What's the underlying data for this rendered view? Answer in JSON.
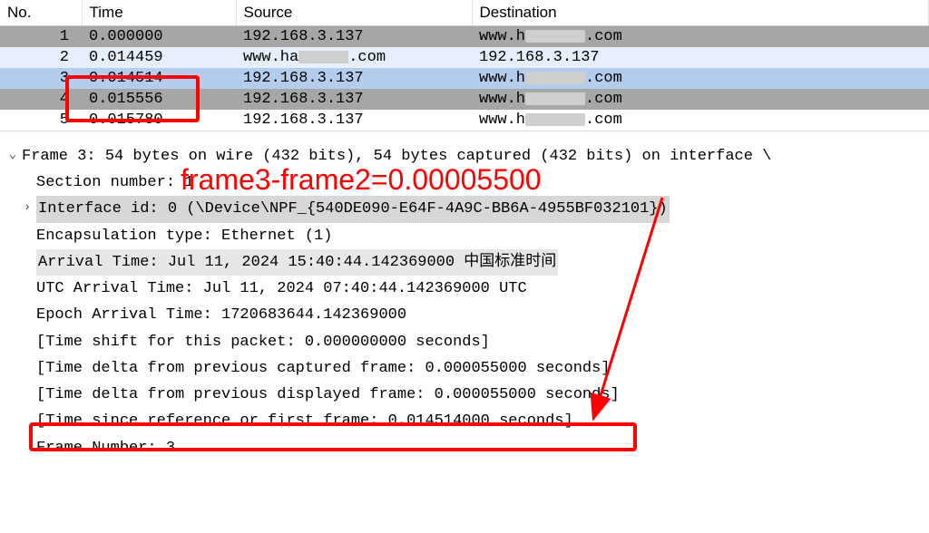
{
  "columns": {
    "no": "No.",
    "time": "Time",
    "source": "Source",
    "destination": "Destination"
  },
  "rows": [
    {
      "no": "1",
      "time": "0.000000",
      "source": "192.168.3.137",
      "dest_prefix": "www.h",
      "dest_suffix": ".com",
      "cls": "row-gray"
    },
    {
      "no": "2",
      "time": "0.014459",
      "source": "www.ha      .com",
      "dest_prefix": "192.168.3.137",
      "dest_suffix": "",
      "cls": "row-lightblue",
      "src_obscured": true
    },
    {
      "no": "3",
      "time": "0.014514",
      "source": "192.168.3.137",
      "dest_prefix": "www.h",
      "dest_suffix": ".com",
      "cls": "row-midblue"
    },
    {
      "no": "4",
      "time": "0.015556",
      "source": "192.168.3.137",
      "dest_prefix": "www.h",
      "dest_suffix": ".com",
      "cls": "row-selected"
    },
    {
      "no": "5",
      "time": "0.015780",
      "source": "192.168.3.137",
      "dest_prefix": "www.h",
      "dest_suffix": ".com",
      "cls": "row-white"
    }
  ],
  "annotation": {
    "text": "frame3-frame2=0.00005500"
  },
  "details": {
    "frame_header": "Frame 3: 54 bytes on wire (432 bits), 54 bytes captured (432 bits) on interface \\",
    "section_number": "Section number: 1",
    "interface_id": "Interface id: 0 (\\Device\\NPF_{540DE090-E64F-4A9C-BB6A-4955BF032101})",
    "encapsulation": "Encapsulation type: Ethernet (1)",
    "arrival_time": "Arrival Time: Jul 11, 2024 15:40:44.142369000 中国标准时间",
    "utc_arrival": "UTC Arrival Time: Jul 11, 2024 07:40:44.142369000 UTC",
    "epoch_arrival": "Epoch Arrival Time: 1720683644.142369000",
    "time_shift": "[Time shift for this packet: 0.000000000 seconds]",
    "time_delta_captured": "[Time delta from previous captured frame: 0.000055000 seconds]",
    "time_delta_displayed": "[Time delta from previous displayed frame: 0.000055000 seconds]",
    "time_since_ref": "[Time since reference or first frame: 0.014514000 seconds]",
    "frame_number": "Frame Number: 3"
  }
}
